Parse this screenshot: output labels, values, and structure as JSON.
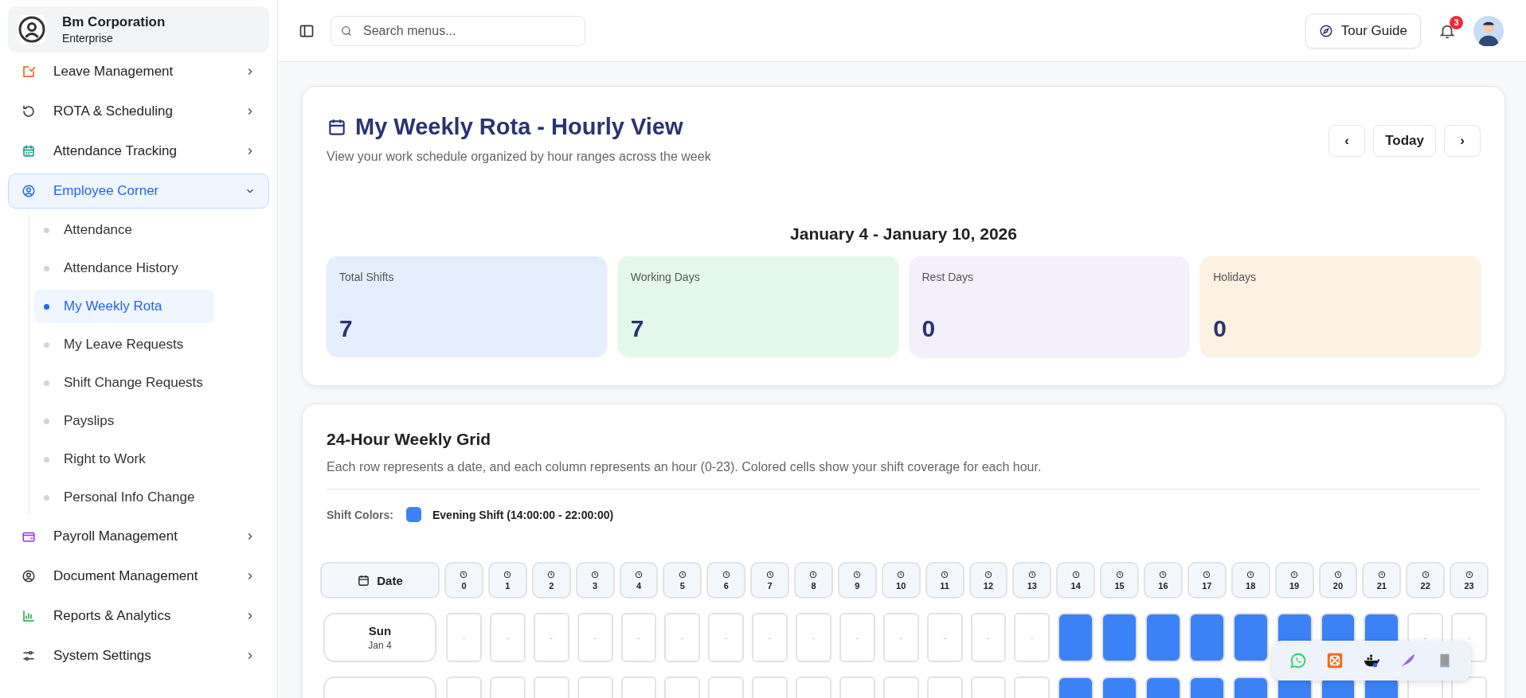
{
  "org": {
    "name": "Bm Corporation",
    "plan": "Enterprise"
  },
  "sidebar": {
    "items": [
      {
        "label": "Leave Management",
        "expanded": false,
        "selected": false
      },
      {
        "label": "ROTA & Scheduling",
        "expanded": false,
        "selected": false
      },
      {
        "label": "Attendance Tracking",
        "expanded": false,
        "selected": false
      },
      {
        "label": "Employee Corner",
        "expanded": true,
        "selected": true,
        "children": [
          {
            "label": "Attendance",
            "selected": false
          },
          {
            "label": "Attendance History",
            "selected": false
          },
          {
            "label": "My Weekly Rota",
            "selected": true
          },
          {
            "label": "My Leave Requests",
            "selected": false
          },
          {
            "label": "Shift Change Requests",
            "selected": false
          },
          {
            "label": "Payslips",
            "selected": false
          },
          {
            "label": "Right to Work",
            "selected": false
          },
          {
            "label": "Personal Info Change",
            "selected": false
          }
        ]
      },
      {
        "label": "Payroll Management",
        "expanded": false,
        "selected": false
      },
      {
        "label": "Document Management",
        "expanded": false,
        "selected": false
      },
      {
        "label": "Reports & Analytics",
        "expanded": false,
        "selected": false
      },
      {
        "label": "System Settings",
        "expanded": false,
        "selected": false
      }
    ]
  },
  "topbar": {
    "search": {
      "placeholder": "Search menus..."
    },
    "tour_button": "Tour Guide",
    "notifications": "3"
  },
  "header": {
    "title": "My Weekly Rota - Hourly View",
    "subtitle": "View your work schedule organized by hour ranges across the week",
    "buttons": [
      "‹",
      "Today",
      "›"
    ],
    "range": "January 4 - January 10, 2026"
  },
  "stats": [
    {
      "label": "Total Shifts",
      "value": "7",
      "color": "#e4eefc"
    },
    {
      "label": "Working Days",
      "value": "7",
      "color": "#e3f8ea"
    },
    {
      "label": "Rest Days",
      "value": "0",
      "color": "#f3effc"
    },
    {
      "label": "Holidays",
      "value": "0",
      "color": "#fdf1e2"
    }
  ],
  "grid": {
    "title": "24-Hour Weekly Grid",
    "description": "Each row represents a date, and each column represents an hour (0-23). Colored cells show your shift coverage for each hour.",
    "legend_label": "Shift Colors:",
    "legend": [
      {
        "label": "Evening Shift (14:00:00 - 22:00:00)",
        "color": "#3b82f6"
      }
    ],
    "date_header": "Date",
    "hours": [
      "0",
      "1",
      "2",
      "3",
      "4",
      "5",
      "6",
      "7",
      "8",
      "9",
      "10",
      "11",
      "12",
      "13",
      "14",
      "15",
      "16",
      "17",
      "18",
      "19",
      "20",
      "21",
      "22",
      "23"
    ],
    "rows": [
      {
        "day": "Sun",
        "date": "Jan 4",
        "cells": [
          {
            "shift": false,
            "text": "-"
          },
          {
            "shift": false,
            "text": "-"
          },
          {
            "shift": false,
            "text": "-"
          },
          {
            "shift": false,
            "text": "-"
          },
          {
            "shift": false,
            "text": "-"
          },
          {
            "shift": false,
            "text": "-"
          },
          {
            "shift": false,
            "text": "-"
          },
          {
            "shift": false,
            "text": "-"
          },
          {
            "shift": false,
            "text": "-"
          },
          {
            "shift": false,
            "text": "-"
          },
          {
            "shift": false,
            "text": "-"
          },
          {
            "shift": false,
            "text": "-"
          },
          {
            "shift": false,
            "text": "-"
          },
          {
            "shift": false,
            "text": "-"
          },
          {
            "shift": true
          },
          {
            "shift": true
          },
          {
            "shift": true
          },
          {
            "shift": true
          },
          {
            "shift": true
          },
          {
            "shift": true
          },
          {
            "shift": true
          },
          {
            "shift": true
          },
          {
            "shift": false,
            "text": "-"
          },
          {
            "shift": false,
            "text": "-"
          }
        ]
      },
      {
        "cells": [
          {
            "shift": false
          },
          {
            "shift": false
          },
          {
            "shift": false
          },
          {
            "shift": false
          },
          {
            "shift": false
          },
          {
            "shift": false
          },
          {
            "shift": false
          },
          {
            "shift": false
          },
          {
            "shift": false
          },
          {
            "shift": false
          },
          {
            "shift": false
          },
          {
            "shift": false
          },
          {
            "shift": false
          },
          {
            "shift": false
          },
          {
            "shift": true
          },
          {
            "shift": true
          },
          {
            "shift": true
          },
          {
            "shift": true
          },
          {
            "shift": true
          },
          {
            "shift": true
          },
          {
            "shift": true
          },
          {
            "shift": true
          },
          {
            "shift": false
          },
          {
            "shift": false
          }
        ]
      }
    ]
  }
}
